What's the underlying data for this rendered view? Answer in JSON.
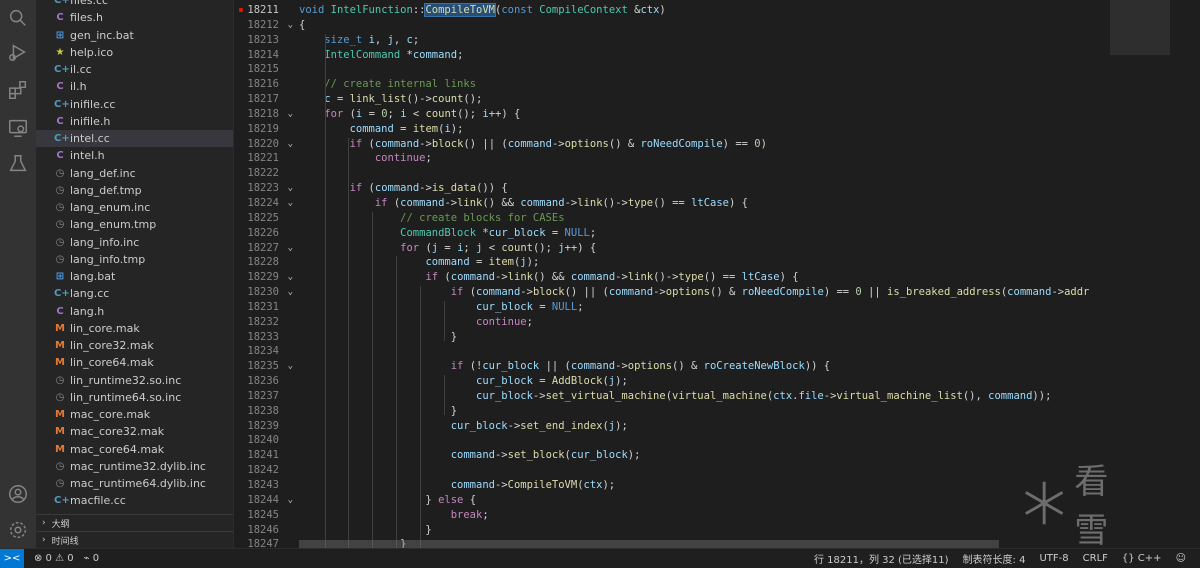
{
  "sidebar": {
    "files": [
      {
        "name": "files.cc",
        "icon": "cc"
      },
      {
        "name": "files.h",
        "icon": "c"
      },
      {
        "name": "gen_inc.bat",
        "icon": "bat"
      },
      {
        "name": "help.ico",
        "icon": "ico"
      },
      {
        "name": "il.cc",
        "icon": "cc"
      },
      {
        "name": "il.h",
        "icon": "c"
      },
      {
        "name": "inifile.cc",
        "icon": "cc"
      },
      {
        "name": "inifile.h",
        "icon": "c"
      },
      {
        "name": "intel.cc",
        "icon": "cc",
        "active": true
      },
      {
        "name": "intel.h",
        "icon": "c"
      },
      {
        "name": "lang_def.inc",
        "icon": "doc"
      },
      {
        "name": "lang_def.tmp",
        "icon": "doc"
      },
      {
        "name": "lang_enum.inc",
        "icon": "doc"
      },
      {
        "name": "lang_enum.tmp",
        "icon": "doc"
      },
      {
        "name": "lang_info.inc",
        "icon": "doc"
      },
      {
        "name": "lang_info.tmp",
        "icon": "doc"
      },
      {
        "name": "lang.bat",
        "icon": "bat"
      },
      {
        "name": "lang.cc",
        "icon": "cc"
      },
      {
        "name": "lang.h",
        "icon": "c"
      },
      {
        "name": "lin_core.mak",
        "icon": "mak"
      },
      {
        "name": "lin_core32.mak",
        "icon": "mak"
      },
      {
        "name": "lin_core64.mak",
        "icon": "mak"
      },
      {
        "name": "lin_runtime32.so.inc",
        "icon": "doc"
      },
      {
        "name": "lin_runtime64.so.inc",
        "icon": "doc"
      },
      {
        "name": "mac_core.mak",
        "icon": "mak"
      },
      {
        "name": "mac_core32.mak",
        "icon": "mak"
      },
      {
        "name": "mac_core64.mak",
        "icon": "mak"
      },
      {
        "name": "mac_runtime32.dylib.inc",
        "icon": "doc"
      },
      {
        "name": "mac_runtime64.dylib.inc",
        "icon": "doc"
      },
      {
        "name": "macfile.cc",
        "icon": "cc"
      }
    ],
    "outline_label": "大纲",
    "timeline_label": "时间线"
  },
  "editor": {
    "lines": [
      {
        "n": "18211",
        "cur": true,
        "bp": true,
        "fold": "",
        "html": "<span class='k'>void</span> <span class='t'>IntelFunction</span>::<span class='f hl'>CompileToVM</span>(<span class='k'>const</span> <span class='t'>CompileContext</span> &amp;<span class='v'>ctx</span>)"
      },
      {
        "n": "18212",
        "fold": "v",
        "html": "{"
      },
      {
        "n": "18213",
        "html": "    <span class='k'>size_t</span> <span class='v'>i</span>, <span class='v'>j</span>, <span class='v'>c</span>;"
      },
      {
        "n": "18214",
        "html": "    <span class='t'>IntelCommand</span> *<span class='v'>command</span>;"
      },
      {
        "n": "18215",
        "html": ""
      },
      {
        "n": "18216",
        "html": "    <span class='cm'>// create internal links</span>"
      },
      {
        "n": "18217",
        "html": "    <span class='v'>c</span> = <span class='f'>link_list</span>()-&gt;<span class='f'>count</span>();"
      },
      {
        "n": "18218",
        "fold": "v",
        "html": "    <span class='c'>for</span> (<span class='v'>i</span> = <span class='n'>0</span>; <span class='v'>i</span> &lt; <span class='f'>count</span>(); <span class='v'>i</span>++) {"
      },
      {
        "n": "18219",
        "html": "        <span class='v'>command</span> = <span class='f'>item</span>(<span class='v'>i</span>);"
      },
      {
        "n": "18220",
        "fold": "v",
        "html": "        <span class='c'>if</span> (<span class='v'>command</span>-&gt;<span class='f'>block</span>() || (<span class='v'>command</span>-&gt;<span class='f'>options</span>() &amp; <span class='v'>roNeedCompile</span>) == <span class='n'>0</span>)"
      },
      {
        "n": "18221",
        "html": "            <span class='c'>continue</span>;"
      },
      {
        "n": "18222",
        "html": ""
      },
      {
        "n": "18223",
        "fold": "v",
        "html": "        <span class='c'>if</span> (<span class='v'>command</span>-&gt;<span class='f'>is_data</span>()) {"
      },
      {
        "n": "18224",
        "fold": "v",
        "html": "            <span class='c'>if</span> (<span class='v'>command</span>-&gt;<span class='f'>link</span>() &amp;&amp; <span class='v'>command</span>-&gt;<span class='f'>link</span>()-&gt;<span class='f'>type</span>() == <span class='v'>ltCase</span>) {"
      },
      {
        "n": "18225",
        "html": "                <span class='cm'>// create blocks for CASEs</span>"
      },
      {
        "n": "18226",
        "html": "                <span class='t'>CommandBlock</span> *<span class='v'>cur_block</span> = <span class='k'>NULL</span>;"
      },
      {
        "n": "18227",
        "fold": "v",
        "html": "                <span class='c'>for</span> (<span class='v'>j</span> = <span class='v'>i</span>; <span class='v'>j</span> &lt; <span class='f'>count</span>(); <span class='v'>j</span>++) {"
      },
      {
        "n": "18228",
        "html": "                    <span class='v'>command</span> = <span class='f'>item</span>(<span class='v'>j</span>);"
      },
      {
        "n": "18229",
        "fold": "v",
        "html": "                    <span class='c'>if</span> (<span class='v'>command</span>-&gt;<span class='f'>link</span>() &amp;&amp; <span class='v'>command</span>-&gt;<span class='f'>link</span>()-&gt;<span class='f'>type</span>() == <span class='v'>ltCase</span>) {"
      },
      {
        "n": "18230",
        "fold": "v",
        "html": "                        <span class='c'>if</span> (<span class='v'>command</span>-&gt;<span class='f'>block</span>() || (<span class='v'>command</span>-&gt;<span class='f'>options</span>() &amp; <span class='v'>roNeedCompile</span>) == <span class='n'>0</span> || <span class='f'>is_breaked_address</span>(<span class='v'>command</span>-&gt;<span class='f'>address</span>())) {"
      },
      {
        "n": "18231",
        "html": "                            <span class='v'>cur_block</span> = <span class='k'>NULL</span>;"
      },
      {
        "n": "18232",
        "html": "                            <span class='c'>continue</span>;"
      },
      {
        "n": "18233",
        "html": "                        }"
      },
      {
        "n": "18234",
        "html": ""
      },
      {
        "n": "18235",
        "fold": "v",
        "html": "                        <span class='c'>if</span> (!<span class='v'>cur_block</span> || (<span class='v'>command</span>-&gt;<span class='f'>options</span>() &amp; <span class='v'>roCreateNewBlock</span>)) {"
      },
      {
        "n": "18236",
        "html": "                            <span class='v'>cur_block</span> = <span class='f'>AddBlock</span>(<span class='v'>j</span>);"
      },
      {
        "n": "18237",
        "html": "                            <span class='v'>cur_block</span>-&gt;<span class='f'>set_virtual_machine</span>(<span class='f'>virtual_machine</span>(<span class='v'>ctx</span>.<span class='v'>file</span>-&gt;<span class='f'>virtual_machine_list</span>(), <span class='v'>command</span>));"
      },
      {
        "n": "18238",
        "html": "                        }"
      },
      {
        "n": "18239",
        "html": "                        <span class='v'>cur_block</span>-&gt;<span class='f'>set_end_index</span>(<span class='v'>j</span>);"
      },
      {
        "n": "18240",
        "html": ""
      },
      {
        "n": "18241",
        "html": "                        <span class='v'>command</span>-&gt;<span class='f'>set_block</span>(<span class='v'>cur_block</span>);"
      },
      {
        "n": "18242",
        "html": ""
      },
      {
        "n": "18243",
        "html": "                        <span class='v'>command</span>-&gt;<span class='f'>CompileToVM</span>(<span class='v'>ctx</span>);"
      },
      {
        "n": "18244",
        "fold": "v",
        "html": "                    } <span class='c'>else</span> {"
      },
      {
        "n": "18245",
        "html": "                        <span class='c'>break</span>;"
      },
      {
        "n": "18246",
        "html": "                    }"
      },
      {
        "n": "18247",
        "html": "                }"
      }
    ]
  },
  "watermark": {
    "text": "看雪"
  },
  "statusbar": {
    "remote": "><",
    "errors": "⊗ 0 ⚠ 0",
    "ports": "⌁ 0",
    "position": "行 18211，列 32 (已选择11)",
    "tabsize": "制表符长度: 4",
    "encoding": "UTF-8",
    "eol": "CRLF",
    "language": "{} C++",
    "feedback": "☺"
  }
}
